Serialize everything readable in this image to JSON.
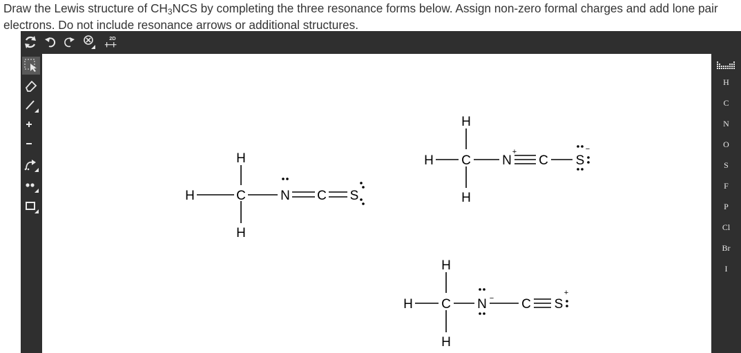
{
  "question": {
    "line1_before": "Draw the Lewis structure of CH",
    "sub": "3",
    "line1_after": "NCS by completing the three resonance forms below. Assign non-zero formal charges and add lone pair electrons. Do not include resonance arrows or additional structures."
  },
  "toolbar": {
    "top": [
      "reset-icon",
      "undo-icon",
      "redo-icon",
      "zoom-icon",
      "2d-clean-icon"
    ],
    "clean_label": "2D",
    "left": [
      "select-icon",
      "eraser-icon",
      "bond-icon",
      "plus-charge-icon",
      "minus-charge-icon",
      "arrow-icon",
      "lone-pair-icon",
      "ring-icon"
    ]
  },
  "elements": [
    "H",
    "C",
    "N",
    "O",
    "S",
    "F",
    "P",
    "Cl",
    "Br",
    "I"
  ],
  "atoms": {
    "H": "H",
    "C": "C",
    "N": "N",
    "S": "S"
  },
  "charges": {
    "plus": "+",
    "minus": "−"
  },
  "colors": {
    "editor_bg": "#2f2f2f",
    "canvas_bg": "#ffffff",
    "text": "#333333",
    "icon": "#e8e8e8"
  }
}
